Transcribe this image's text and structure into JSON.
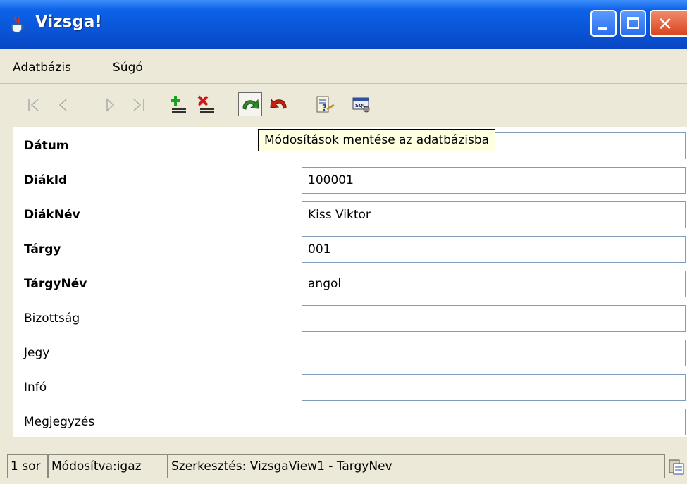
{
  "window": {
    "title": "Vizsga!",
    "icon": "java-cup-icon",
    "controls": {
      "minimize": "minimize-icon",
      "maximize": "maximize-icon",
      "close": "close-icon",
      "close_glyph": "✕"
    }
  },
  "menubar": {
    "items": [
      {
        "label": "Adatbázis"
      },
      {
        "label": "Súgó"
      }
    ]
  },
  "toolbar": {
    "buttons": [
      {
        "icon": "first-record-icon",
        "enabled": false
      },
      {
        "icon": "previous-record-icon",
        "enabled": false
      },
      {
        "icon": "next-record-icon",
        "enabled": false
      },
      {
        "icon": "last-record-icon",
        "enabled": false
      },
      {
        "icon": "insert-record-icon",
        "enabled": true
      },
      {
        "icon": "delete-record-icon",
        "enabled": true
      },
      {
        "icon": "save-changes-icon",
        "enabled": true,
        "pressed": true
      },
      {
        "icon": "undo-changes-icon",
        "enabled": true
      },
      {
        "icon": "query-icon",
        "enabled": true
      },
      {
        "icon": "sql-icon",
        "enabled": true
      }
    ],
    "tooltip": "Módosítások mentése az adatbázisba"
  },
  "form": {
    "fields": [
      {
        "label": "Dátum",
        "value": "",
        "bold": true
      },
      {
        "label": "DiákId",
        "value": "100001",
        "bold": true
      },
      {
        "label": "DiákNév",
        "value": "Kiss Viktor",
        "bold": true
      },
      {
        "label": "Tárgy",
        "value": "001",
        "bold": true
      },
      {
        "label": "TárgyNév",
        "value": "angol",
        "bold": true
      },
      {
        "label": "Bizottság",
        "value": "",
        "bold": false
      },
      {
        "label": "Jegy",
        "value": "",
        "bold": false
      },
      {
        "label": "Infó",
        "value": "",
        "bold": false
      },
      {
        "label": "Megjegyzés",
        "value": "",
        "bold": false
      }
    ]
  },
  "statusbar": {
    "rows": "1 sor",
    "modified": "Módosítva:igaz",
    "editing": "Szerkesztés: VizsgaView1 - TargyNev",
    "icon": "clipboard-icon"
  },
  "colors": {
    "titlebar": "#0a55d8",
    "tooltip_bg": "#ffffe1",
    "field_border": "#7f9db9",
    "window_bg": "#ece9d8"
  }
}
